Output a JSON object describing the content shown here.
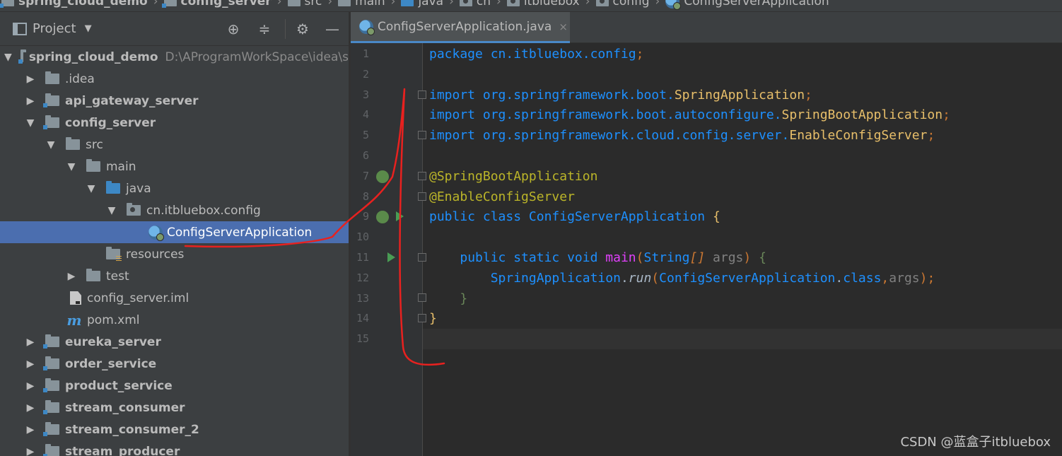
{
  "breadcrumb": [
    {
      "label": "spring_cloud_demo",
      "bold": true
    },
    {
      "label": "config_server",
      "bold": true
    },
    {
      "label": "src"
    },
    {
      "label": "main"
    },
    {
      "label": "java"
    },
    {
      "label": "cn"
    },
    {
      "label": "itbluebox"
    },
    {
      "label": "config"
    },
    {
      "label": "ConfigServerApplication"
    }
  ],
  "project_panel": {
    "title": "Project",
    "dropdown": "▼",
    "tree": [
      {
        "label": "spring_cloud_demo",
        "path": "D:\\AProgramWorkSpace\\idea\\s",
        "bold": true,
        "arrow": "▼",
        "icon": "module-folder-icon"
      },
      {
        "label": ".idea",
        "arrow": "▶",
        "icon": "folder-icon"
      },
      {
        "label": "api_gateway_server",
        "bold": true,
        "arrow": "▶",
        "icon": "module-folder-icon"
      },
      {
        "label": "config_server",
        "bold": true,
        "arrow": "▼",
        "icon": "module-folder-icon"
      },
      {
        "label": "src",
        "arrow": "▼",
        "icon": "folder-icon"
      },
      {
        "label": "main",
        "arrow": "▼",
        "icon": "folder-icon"
      },
      {
        "label": "java",
        "arrow": "▼",
        "icon": "source-folder-icon"
      },
      {
        "label": "cn.itbluebox.config",
        "arrow": "▼",
        "icon": "package-icon"
      },
      {
        "label": "ConfigServerApplication",
        "arrow": "",
        "icon": "spring-boot-class-icon",
        "selected": true
      },
      {
        "label": "resources",
        "arrow": "",
        "icon": "resources-folder-icon"
      },
      {
        "label": "test",
        "arrow": "▶",
        "icon": "folder-icon"
      },
      {
        "label": "config_server.iml",
        "arrow": "",
        "icon": "iml-file-icon"
      },
      {
        "label": "pom.xml",
        "arrow": "",
        "icon": "maven-icon"
      },
      {
        "label": "eureka_server",
        "bold": true,
        "arrow": "▶",
        "icon": "module-folder-icon"
      },
      {
        "label": "order_service",
        "bold": true,
        "arrow": "▶",
        "icon": "module-folder-icon"
      },
      {
        "label": "product_service",
        "bold": true,
        "arrow": "▶",
        "icon": "module-folder-icon"
      },
      {
        "label": "stream_consumer",
        "bold": true,
        "arrow": "▶",
        "icon": "module-folder-icon"
      },
      {
        "label": "stream_consumer_2",
        "bold": true,
        "arrow": "▶",
        "icon": "module-folder-icon"
      },
      {
        "label": "stream_producer",
        "bold": true,
        "arrow": "▶",
        "icon": "module-folder-icon"
      }
    ]
  },
  "editor": {
    "tab_label": "ConfigServerApplication.java",
    "tab_close": "×",
    "line_numbers": [
      "1",
      "2",
      "3",
      "4",
      "5",
      "6",
      "7",
      "8",
      "9",
      "10",
      "11",
      "12",
      "13",
      "14",
      "15"
    ],
    "current_line": 15
  },
  "watermark": "CSDN @蓝盒子itbluebox",
  "colors": {
    "selection": "#4b6eaf",
    "annotation_stroke": "#e8211f",
    "background": "#2b2b2b"
  }
}
